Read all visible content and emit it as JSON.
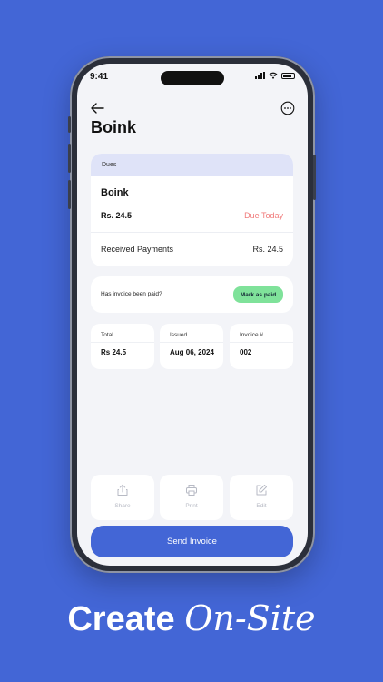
{
  "status_bar": {
    "time": "9:41"
  },
  "header": {
    "title": "Boink"
  },
  "dues": {
    "header_label": "Dues",
    "name": "Boink",
    "amount": "Rs. 24.5",
    "status": "Due Today",
    "received_label": "Received Payments",
    "received_amount": "Rs. 24.5"
  },
  "payment_check": {
    "question": "Has invoice been paid?",
    "button_label": "Mark as paid"
  },
  "summary": [
    {
      "label": "Total",
      "value": "Rs 24.5"
    },
    {
      "label": "Issued",
      "value": "Aug 06, 2024"
    },
    {
      "label": "Invoice #",
      "value": "002"
    }
  ],
  "actions": [
    {
      "label": "Share",
      "icon": "share-icon"
    },
    {
      "label": "Print",
      "icon": "print-icon"
    },
    {
      "label": "Edit",
      "icon": "edit-icon"
    }
  ],
  "send_button": "Send Invoice",
  "caption": {
    "bold": "Create",
    "italic": "On-Site"
  },
  "colors": {
    "background": "#4366d6",
    "due": "#f07a7a",
    "paid_button": "#7fe29a",
    "dues_header": "#dfe3f8"
  }
}
